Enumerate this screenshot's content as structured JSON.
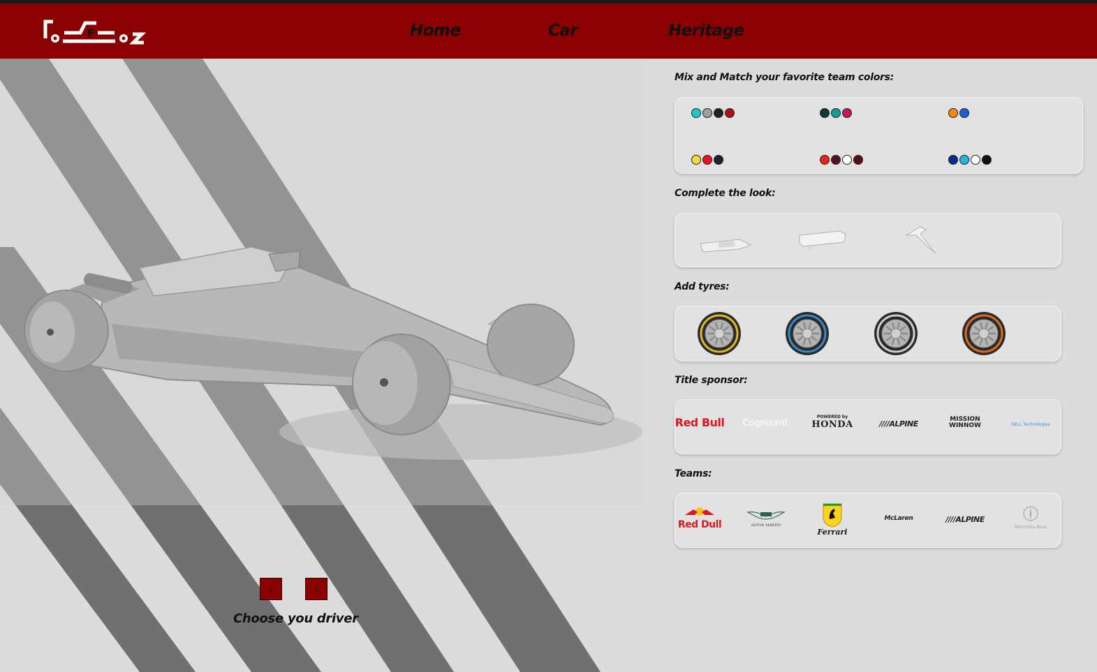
{
  "nav": {
    "logo_alt": "F1 2022 logo",
    "links": [
      "Home",
      "Car",
      "Heritage"
    ]
  },
  "colors": {
    "brand_red": "#8b0000",
    "background": "#dcdcdc",
    "stripe": "#707070"
  },
  "driver": {
    "prev_label": "‹",
    "next_label": "›",
    "choose_label": "Choose you driver"
  },
  "sections": {
    "team_colors_title": "Mix and Match your favorite team colors:",
    "complete_look_title": "Complete the look:",
    "tyres_title": "Add tyres:",
    "sponsor_title": "Title sponsor:",
    "teams_title": "Teams:"
  },
  "team_color_sets": [
    [
      "#1ec8c8",
      "#a0a0a0",
      "#222222",
      "#b0101a"
    ],
    [
      "#0b3b35",
      "#169c98",
      "#c2185b"
    ],
    [
      "#f08a10",
      "#1e5fd8"
    ],
    [
      "#f5d93a",
      "#e8141f",
      "#1c2234"
    ],
    [
      "#e8251d",
      "#5a0f20",
      "#ffffff",
      "#5c0d12"
    ],
    [
      "#0a2a8c",
      "#20b6e8",
      "#ffffff",
      "#111111"
    ]
  ],
  "parts": [
    "front-wing",
    "rear-wing",
    "halo"
  ],
  "tyres": [
    {
      "name": "soft",
      "color": "#e0b920"
    },
    {
      "name": "medium",
      "color": "#3d87c9"
    },
    {
      "name": "hard",
      "color": "#cfcfcf"
    },
    {
      "name": "intermediate",
      "color": "#e06a1e"
    }
  ],
  "sponsors": [
    "Red Bull",
    "Cognizant",
    "HONDA",
    "////ALPINE",
    "MISSION WINNOW",
    "DELL Technologies"
  ],
  "sponsor_extras": {
    "honda_top": "POWERED by"
  },
  "teams": [
    "Red Dull",
    "ASTON MARTIN",
    "Ferrari",
    "McLaren",
    "////ALPINE",
    "Mercedes-Benz"
  ]
}
